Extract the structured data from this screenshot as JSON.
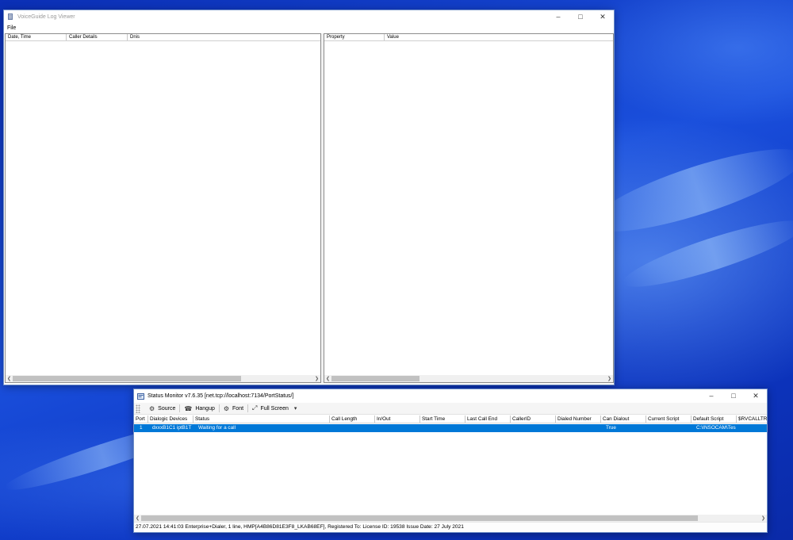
{
  "log_viewer": {
    "title": "VoiceGuide Log Viewer",
    "menu": [
      "File"
    ],
    "left_columns": [
      "Date, Time",
      "Caller Details",
      "Dnis"
    ],
    "right_columns": [
      "Property",
      "Value"
    ]
  },
  "status_monitor": {
    "title": "Status Monitor v7.6.35 [net.tcp://localhost:7134/PortStatus/]",
    "toolbar": {
      "source": "Source",
      "hangup": "Hangup",
      "font": "Font",
      "full_screen": "Full Screen"
    },
    "columns": [
      "Port",
      "Dialogic Devices",
      "Status",
      "Call Length",
      "In/Out",
      "Start Time",
      "Last Call End",
      "CallerID",
      "Dialed Number",
      "Can Dialout",
      "Current Script",
      "Default Script",
      "$RVCALLTRA"
    ],
    "rows": [
      {
        "port": "1",
        "devices": "dxxxB1C1 iptB1T",
        "status": "Waiting for a call",
        "call_length": "",
        "in_out": "",
        "start_time": "",
        "last_call_end": "",
        "caller_id": "",
        "dialed_number": "",
        "can_dialout": "True",
        "current_script": "",
        "default_script": "C:\\INSOCAM\\Tes",
        "rvcalltra": ""
      }
    ],
    "status_bar": "27.07.2021 14:41:03  Enterprise+Dialer, 1 line, HMP[A4B86D81E3F8_LKAB68EF], Registered To: License ID: 19538 Issue Date: 27 July 2021"
  }
}
